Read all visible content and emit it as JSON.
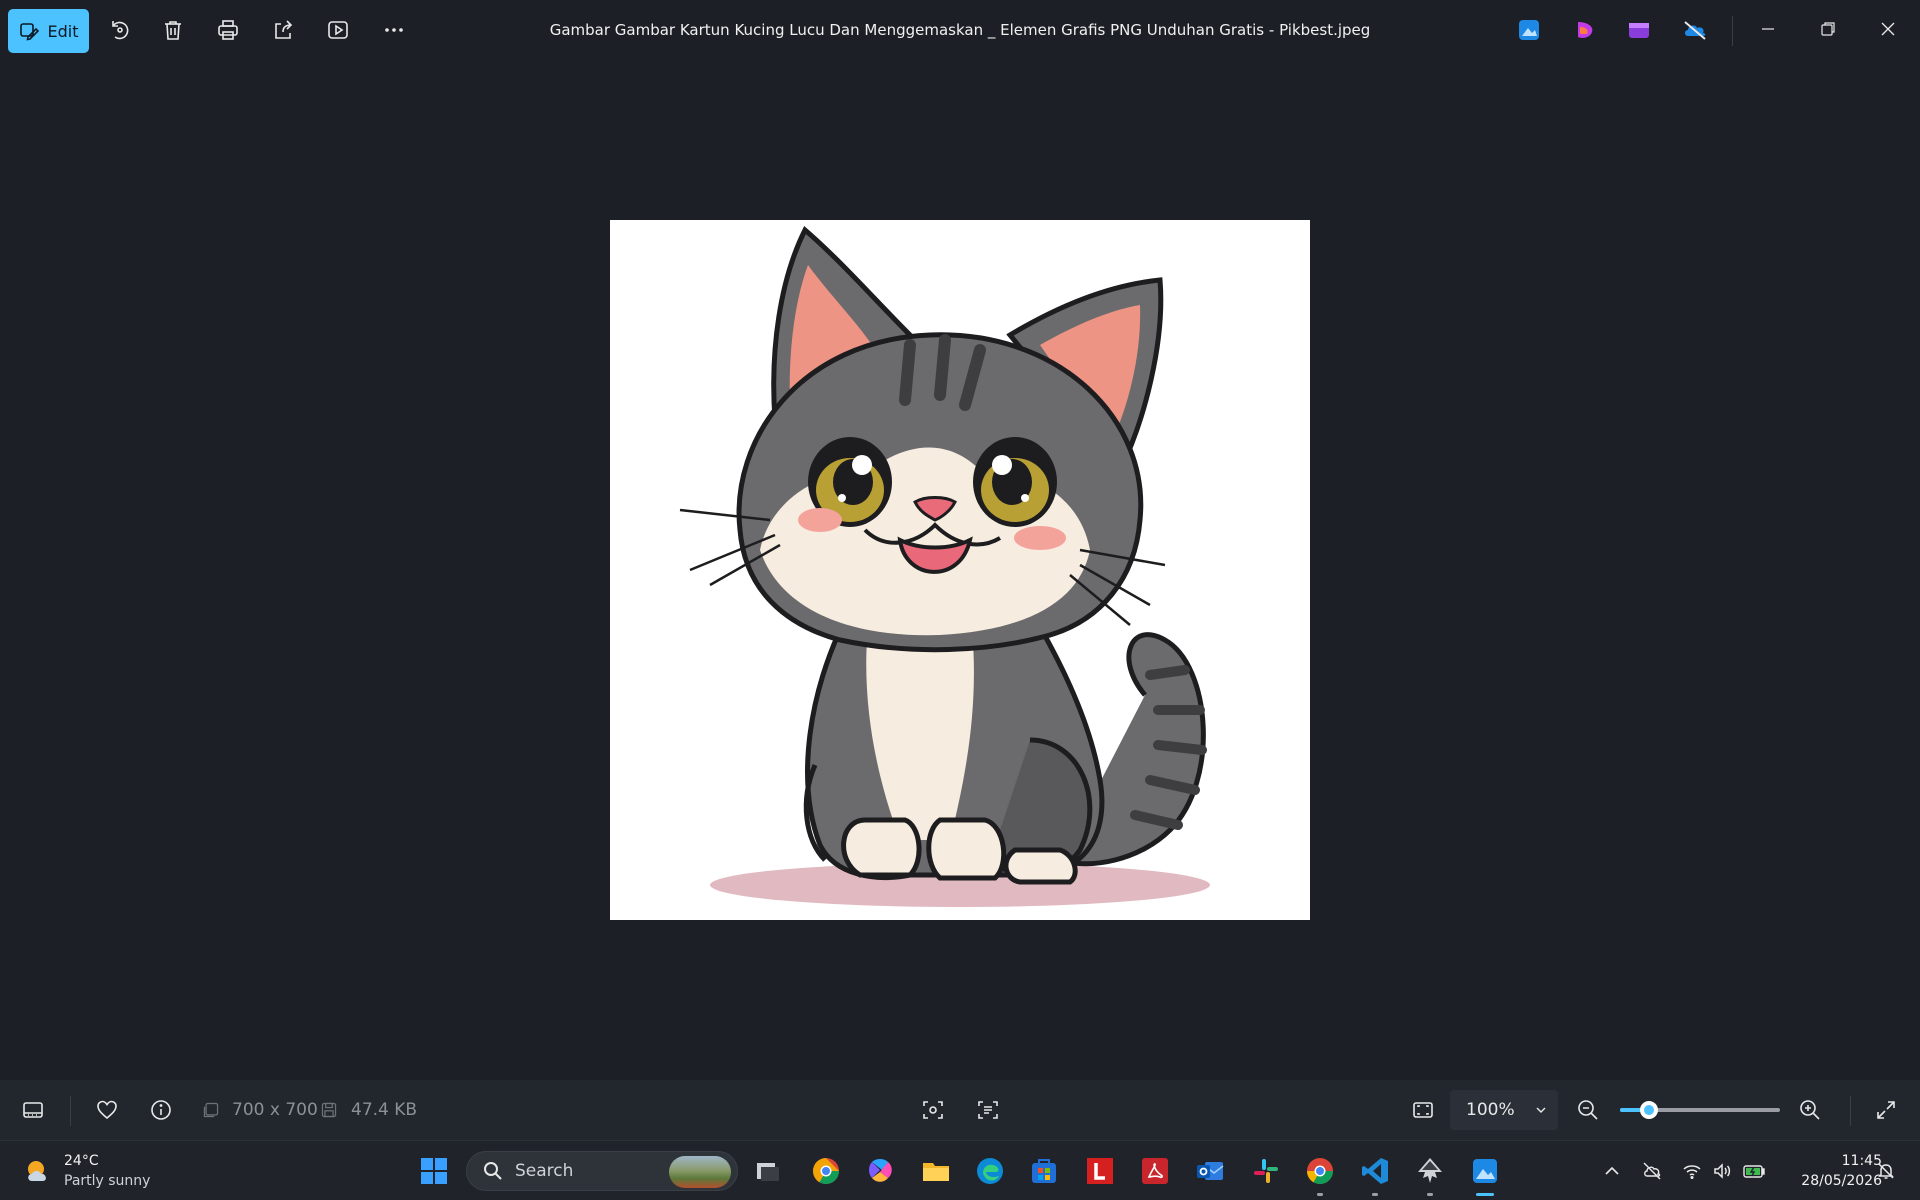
{
  "toolbar": {
    "edit_label": "Edit",
    "window_title": "Gambar Gambar Kartun Kucing Lucu Dan Menggemaskan _ Elemen Grafis PNG Unduhan Gratis - Pikbest.jpeg"
  },
  "image_info": {
    "dimensions": "700 x 700",
    "file_size": "47.4 KB"
  },
  "zoom": {
    "value": "100%",
    "slider_fraction": 0.18
  },
  "taskbar": {
    "weather_temp": "24°C",
    "weather_desc": "Partly sunny",
    "search_label": "Search",
    "time": "11:45",
    "date": "28/05/2026"
  },
  "colors": {
    "accent": "#4cc2ff",
    "background": "#1c2026"
  }
}
